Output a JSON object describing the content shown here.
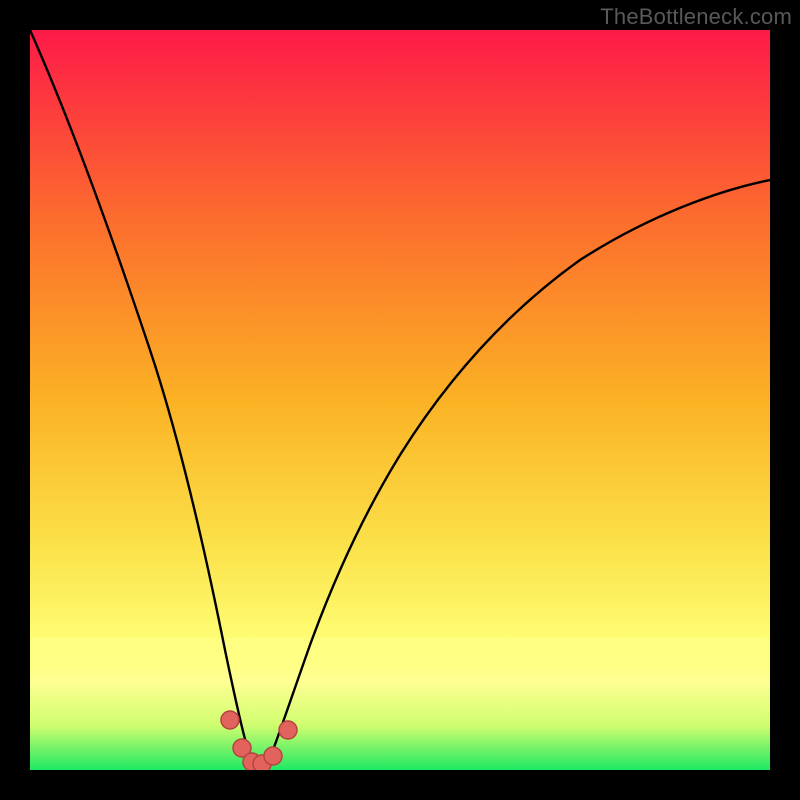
{
  "watermark": "TheBottleneck.com",
  "colors": {
    "bg_black": "#000000",
    "gradient_top": "#fd1a48",
    "gradient_mid1": "#fc7e2a",
    "gradient_mid2": "#fbe623",
    "gradient_yellow_band": "#feff84",
    "gradient_bottom": "#1de963",
    "curve": "#000000",
    "marker_fill": "#e2635e",
    "marker_stroke": "#a53b39"
  },
  "chart_data": {
    "type": "line",
    "title": "",
    "xlabel": "",
    "ylabel": "",
    "xlim": [
      0,
      100
    ],
    "ylim": [
      0,
      100
    ],
    "series": [
      {
        "name": "bottleneck-curve",
        "x": [
          0,
          2,
          5,
          8,
          11,
          14,
          17,
          20,
          22,
          24,
          26,
          27,
          28,
          29,
          30,
          31,
          32,
          34,
          36,
          38,
          41,
          45,
          50,
          55,
          60,
          66,
          73,
          80,
          88,
          96,
          100
        ],
        "y": [
          100,
          91,
          80,
          69,
          58,
          47,
          36,
          25,
          18,
          11,
          6,
          3.5,
          2,
          1.2,
          1,
          1.2,
          2,
          4,
          7,
          11,
          17,
          24,
          32,
          38,
          44,
          50,
          56,
          62,
          68,
          73,
          76
        ]
      }
    ],
    "markers": {
      "name": "highlighted-points",
      "x": [
        25.5,
        27.0,
        28.5,
        30.0,
        31.5,
        33.0
      ],
      "y": [
        7.5,
        3.0,
        1.3,
        1.0,
        1.6,
        4.5
      ]
    },
    "notes": "Axes are unlabeled; values are estimated relative positions (0–100). Curve shows a sharp V-shaped dip near x≈30 reaching ~0, with the right branch tapering off near y≈76 at x=100."
  }
}
